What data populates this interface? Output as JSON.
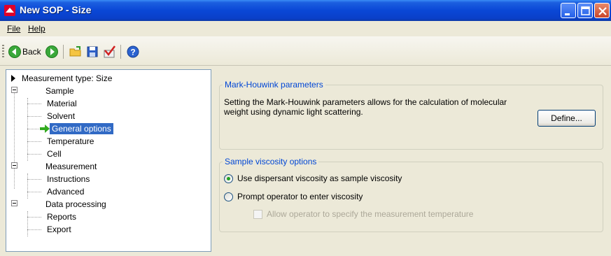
{
  "window": {
    "title": "New SOP - Size",
    "accent": "#0a47d6",
    "controls": [
      "minimize-icon",
      "maximize-icon",
      "close-icon"
    ]
  },
  "menu": {
    "file_label": "File",
    "help_label": "Help"
  },
  "toolbar": {
    "back_label": "Back",
    "icons": [
      "back-arrow-icon",
      "forward-arrow-icon",
      "open-folder-icon",
      "save-icon",
      "check-icon",
      "help-icon"
    ]
  },
  "tree": {
    "items": [
      {
        "label": "Measurement type: Size",
        "level": 0,
        "marker": "triangle-right-icon"
      },
      {
        "label": "Sample",
        "level": 0,
        "marker": "minus-box-icon"
      },
      {
        "label": "Material",
        "level": 1
      },
      {
        "label": "Solvent",
        "level": 1
      },
      {
        "label": "General options",
        "level": 1,
        "selected": true,
        "marker": "green-arrow-icon"
      },
      {
        "label": "Temperature",
        "level": 1
      },
      {
        "label": "Cell",
        "level": 1
      },
      {
        "label": "Measurement",
        "level": 0,
        "marker": "minus-box-icon"
      },
      {
        "label": "Instructions",
        "level": 1
      },
      {
        "label": "Advanced",
        "level": 1
      },
      {
        "label": "Data processing",
        "level": 0,
        "marker": "minus-box-icon"
      },
      {
        "label": "Reports",
        "level": 1
      },
      {
        "label": "Export",
        "level": 1
      }
    ]
  },
  "mark_houwink": {
    "title": "Mark-Houwink parameters",
    "description_line1": "Setting the Mark-Houwink parameters allows for the calculation of molecular",
    "description_line2": "weight using dynamic light scattering.",
    "define_label": "Define..."
  },
  "viscosity": {
    "title": "Sample viscosity options",
    "option1": "Use dispersant viscosity as sample viscosity",
    "option1_checked": true,
    "option2": "Prompt operator to enter viscosity",
    "option2_checked": false,
    "sub_option": "Allow operator to specify the measurement temperature",
    "sub_option_enabled": false
  }
}
